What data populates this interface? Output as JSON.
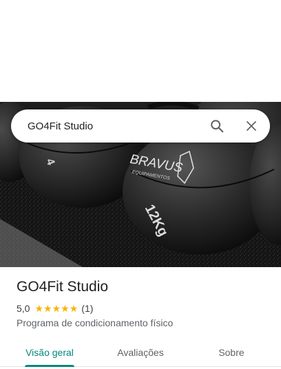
{
  "search": {
    "value": "GO4Fit Studio",
    "search_icon": "search-icon",
    "close_icon": "close-icon"
  },
  "hero": {
    "brand_text": "BRAVUS",
    "brand_subtext": "EQUIPAMENTOS",
    "weight_text": "12Kg"
  },
  "place": {
    "name": "GO4Fit Studio",
    "rating": "5,0",
    "stars": 5,
    "review_count": "(1)",
    "category": "Programa de condicionamento físico"
  },
  "tabs": [
    {
      "label": "Visão geral",
      "active": true
    },
    {
      "label": "Avaliações",
      "active": false
    },
    {
      "label": "Sobre",
      "active": false
    }
  ],
  "colors": {
    "accent": "#00897b",
    "star": "#f8b400",
    "text_primary": "#202124",
    "text_secondary": "#5f6368"
  }
}
